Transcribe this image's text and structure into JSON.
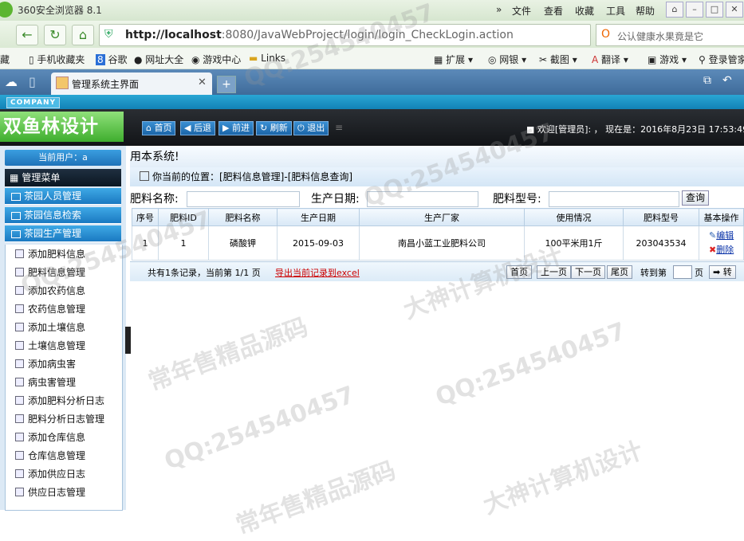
{
  "browser": {
    "title": "360安全浏览器 8.1",
    "menu": [
      "文件",
      "查看",
      "收藏",
      "工具",
      "帮助"
    ],
    "url_host": "http://localhost",
    "url_path": ":8080/JavaWebProject/login/login_CheckLogin.action",
    "search_text": "公认健康水果竟是它",
    "favorites": [
      "藏",
      "手机收藏夹",
      "谷歌",
      "网址大全",
      "游戏中心",
      "Links"
    ],
    "tools": [
      "扩展",
      "网银",
      "截图",
      "翻译",
      "游戏",
      "登录管家"
    ],
    "tab_title": "管理系统主界面"
  },
  "app": {
    "company": "COMPANY",
    "logo": "双鱼林设计",
    "nav_buttons": [
      "首页",
      "后退",
      "前进",
      "刷新",
      "退出"
    ],
    "welcome": "欢迎[管理员]: ， 现在是：2016年8月23日  17:53:49",
    "current_user": "当前用户：a",
    "menu_title": "管理菜单",
    "sections": [
      "茶园人员管理",
      "茶园信息检索",
      "茶园生产管理"
    ],
    "menu_items": [
      "添加肥料信息",
      "肥料信息管理",
      "添加农药信息",
      "农药信息管理",
      "添加土壤信息",
      "土壤信息管理",
      "添加病虫害",
      "病虫害管理",
      "添加肥料分析日志",
      "肥料分析日志管理",
      "添加仓库信息",
      "仓库信息管理",
      "添加供应日志",
      "供应日志管理"
    ]
  },
  "content": {
    "system_text": "用本系统!",
    "location": "你当前的位置：[肥料信息管理]-[肥料信息查询]",
    "filters": {
      "name_label": "肥料名称:",
      "date_label": "生产日期:",
      "model_label": "肥料型号:",
      "query_button": "查询"
    },
    "columns": [
      "序号",
      "肥料ID",
      "肥料名称",
      "生产日期",
      "生产厂家",
      "使用情况",
      "肥料型号",
      "基本操作"
    ],
    "rows": [
      {
        "seq": "1",
        "id": "1",
        "name": "磷酸钾",
        "date": "2015-09-03",
        "maker": "南昌小蓝工业肥料公司",
        "usage": "100平米用1斤",
        "model": "203043534",
        "edit": "编辑",
        "delete": "删除"
      }
    ],
    "pager": {
      "info": "共有1条记录，当前第 1/1 页",
      "export": "导出当前记录到excel",
      "first": "首页",
      "prev": "上一页",
      "next": "下一页",
      "last": "尾页",
      "goto": "转到第",
      "page_unit": "页",
      "go": "➡ 转"
    }
  },
  "watermark": [
    "QQ:254540457",
    "大神计算机设计",
    "常年售精品源码"
  ]
}
